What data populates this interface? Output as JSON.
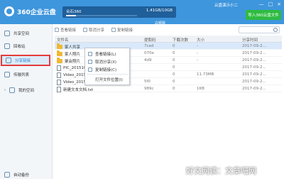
{
  "app": {
    "title": "360企业云盘",
    "accent": "#3e96dd",
    "brand_green": "#2ebb41"
  },
  "account": {
    "name": "合石360",
    "usage": "1.41GB/10GB",
    "usage_fraction": 0.141,
    "level_label": "白银版",
    "user_name": "云盘演示小二"
  },
  "header": {
    "import_button": "导入360云盘文件",
    "window_controls": [
      "—",
      "□",
      "×"
    ]
  },
  "sidebar": {
    "items": [
      {
        "label": "共享空间",
        "icon": "share-space-icon"
      },
      {
        "label": "回收站",
        "icon": "trash-icon"
      },
      {
        "label": "分享链接",
        "icon": "share-link-icon"
      },
      {
        "label": "传输列表",
        "icon": "transfer-icon"
      },
      {
        "label": "我的空间",
        "icon": "my-space-icon"
      }
    ],
    "active_index": 2,
    "bottom_label": "自动备份"
  },
  "toolbar": {
    "items": [
      "查看链接",
      "取消分享",
      "复制链接"
    ]
  },
  "table": {
    "headers": [
      "文件名",
      "提取码",
      "下载次数",
      "大小",
      "分享时间"
    ],
    "rows": [
      {
        "name": "家人共享",
        "type": "folder",
        "code": "7cad",
        "downloads": "0",
        "size": "-",
        "time": "2017-09-2..."
      },
      {
        "name": "家人照片",
        "type": "folder",
        "code": "070e",
        "downloads": "0",
        "size": "-",
        "time": "2017-09-2..."
      },
      {
        "name": "聚会照片",
        "type": "folder",
        "code": "4d9",
        "downloads": "0",
        "size": "-",
        "time": "2017-09-2..."
      },
      {
        "name": "PIC_201510",
        "type": "file",
        "code": "",
        "downloads": "0",
        "size": "",
        "time": "2017-09-2..."
      },
      {
        "name": "Video_2015",
        "type": "file",
        "code": "",
        "downloads": "0",
        "size": "11.73MB",
        "time": "2017-09-2..."
      },
      {
        "name": "Video_2015",
        "type": "file",
        "code": "5f0",
        "downloads": "0",
        "size": "",
        "time": "2017-09-2..."
      },
      {
        "name": "新建文本文档.txt",
        "type": "file",
        "code": "989c",
        "downloads": "0",
        "size": "1KB",
        "time": "2017-09-2..."
      }
    ]
  },
  "context_menu": {
    "items": [
      "查看链接(L)",
      "取消分享(X)",
      "复制链接(C)"
    ],
    "extra": "打开文件位置(I)"
  },
  "watermark": "好文网读：文章吧网"
}
